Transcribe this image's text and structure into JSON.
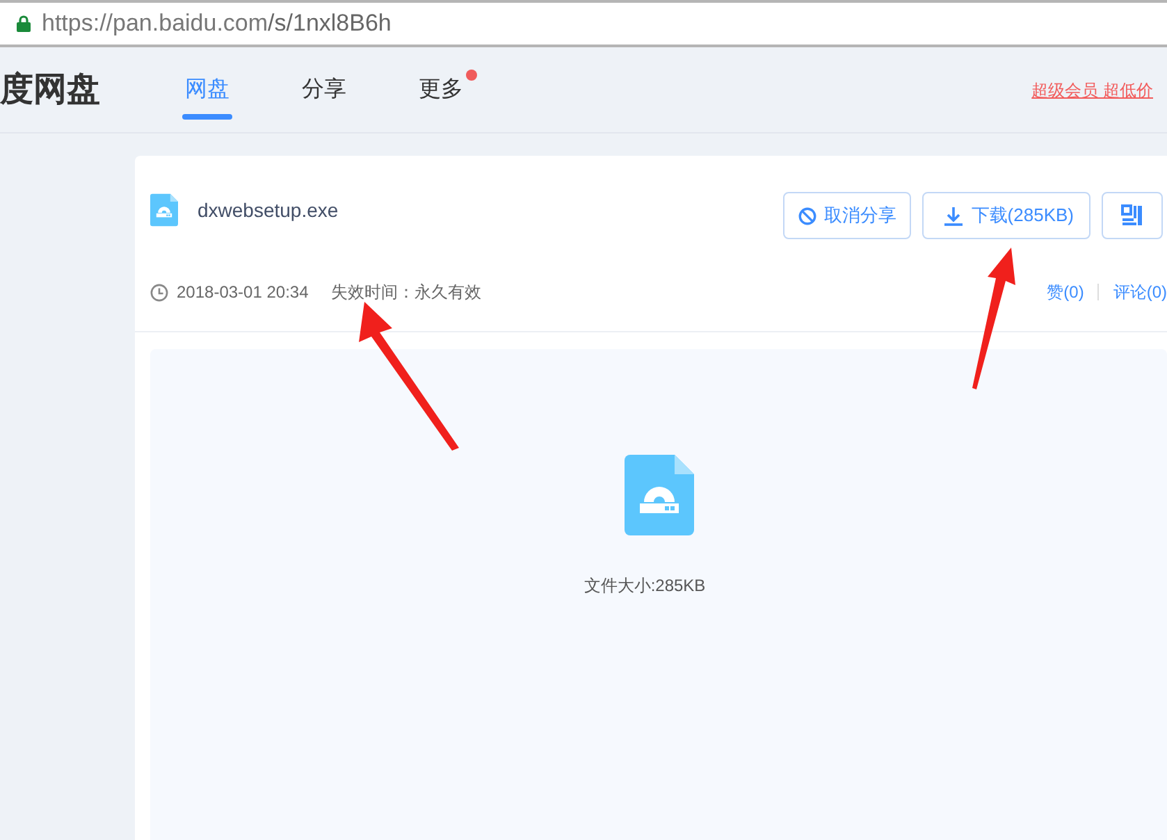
{
  "address_bar": {
    "url_host": "https://pan.baidu.com",
    "url_path": "/s/1nxl8B6h",
    "secure": true
  },
  "header": {
    "logo": "度网盘",
    "tabs": [
      {
        "label": "网盘",
        "selected": true,
        "dot": false
      },
      {
        "label": "分享",
        "selected": false,
        "dot": false
      },
      {
        "label": "更多",
        "selected": false,
        "dot": true
      }
    ],
    "promo_link": "超级会员 超低价"
  },
  "file": {
    "name": "dxwebsetup.exe",
    "date": "2018-03-01 20:34",
    "expiry": "失效时间：永久有效",
    "buttons": [
      {
        "kind": "cancel",
        "label": "取消分享"
      },
      {
        "kind": "download",
        "label": "下载(285KB)"
      },
      {
        "kind": "qr"
      }
    ],
    "likes": "赞(0)",
    "comments": "评论(0)",
    "size": "文件大小:285KB"
  }
}
